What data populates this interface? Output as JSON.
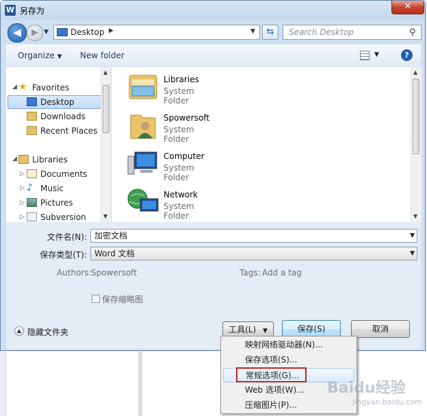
{
  "window": {
    "title": "另存为",
    "app_icon_letter": "W",
    "close_glyph": "✕"
  },
  "nav": {
    "address": "Desktop",
    "search_placeholder": "Search Desktop"
  },
  "toolbar": {
    "organize": "Organize",
    "new_folder": "New folder"
  },
  "navpane": {
    "favorites_header": "Favorites",
    "favorites": [
      "Desktop",
      "Downloads",
      "Recent Places"
    ],
    "selected": "Desktop",
    "libraries_header": "Libraries",
    "libraries": [
      "Documents",
      "Music",
      "Pictures",
      "Subversion"
    ]
  },
  "files": [
    {
      "name": "Libraries",
      "type": "System Folder",
      "icon": "libraries-icon"
    },
    {
      "name": "Spowersoft",
      "type": "System Folder",
      "icon": "user-folder-icon"
    },
    {
      "name": "Computer",
      "type": "System Folder",
      "icon": "computer-icon"
    },
    {
      "name": "Network",
      "type": "System Folder",
      "icon": "network-icon"
    }
  ],
  "form": {
    "filename_label": "文件名(N):",
    "filename_value": "加密文档",
    "filetype_label": "保存类型(T):",
    "filetype_value": "Word 文档",
    "authors_label": "Authors:",
    "authors_value": "Spowersoft",
    "tags_label": "Tags:",
    "tags_value": "Add a tag",
    "thumbnail_label": "保存缩略图"
  },
  "buttons": {
    "hide_folders": "隐藏文件夹",
    "tools": "工具(L)",
    "save": "保存(S)",
    "cancel": "取消"
  },
  "tools_menu": {
    "items": [
      "映射网络驱动器(N)...",
      "保存选项(S)...",
      "常规选项(G)...",
      "Web 选项(W)...",
      "压缩图片(P)..."
    ],
    "highlighted": "常规选项(G)..."
  },
  "watermark": {
    "brand": "Baidu经验",
    "url": "jingyan.baidu.com"
  },
  "colors": {
    "accent": "#1f5fb0",
    "highlight_box": "#c0261e"
  }
}
